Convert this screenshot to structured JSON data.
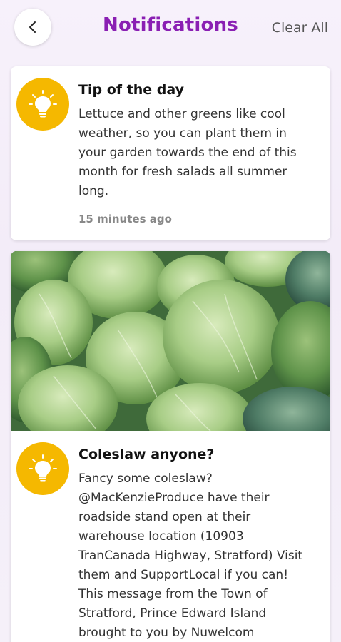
{
  "header": {
    "title": "Notifications",
    "clear_all": "Clear All"
  },
  "notifications": [
    {
      "title": "Tip of the day",
      "body": "Lettuce and other greens like cool weather, so you can plant them in your garden towards the end of this month for fresh salads all summer long.",
      "time": "15 minutes ago",
      "icon": "lightbulb-icon"
    },
    {
      "title": "Coleslaw anyone?",
      "body": "Fancy some coleslaw? @MacKenzieProduce have their roadside stand open at their warehouse location (10903 TranCanada Highway, Stratford) Visit them and SupportLocal if you can! This message from the Town of Stratford, Prince Edward Island brought to you by Nuwelcom",
      "icon": "lightbulb-icon",
      "image": "cabbage-photo"
    }
  ],
  "colors": {
    "accent": "#8a1fb3",
    "icon_bg": "#f5b800"
  }
}
